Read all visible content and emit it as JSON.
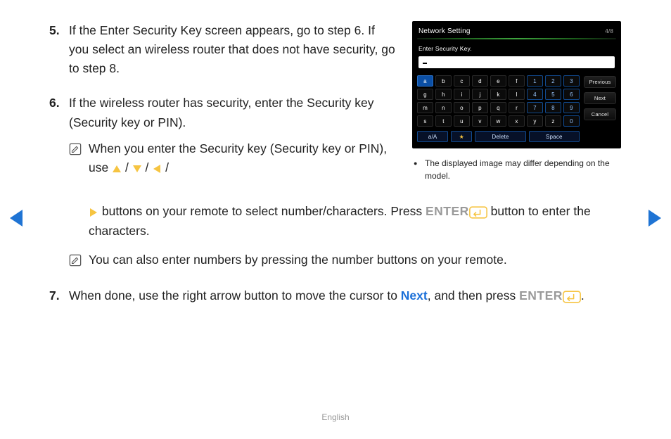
{
  "steps": {
    "s5": {
      "num": "5.",
      "text": "If the Enter Security Key screen appears, go to step 6. If you select an wireless router that does not have security, go to step 8."
    },
    "s6": {
      "num": "6.",
      "text": "If the wireless router has security, enter the Security key (Security key or PIN)."
    },
    "note1a": "When you enter the Security key (Security key or PIN), use ",
    "note1b": " buttons on your remote to select number/characters. Press ",
    "note1c": " button to enter the characters.",
    "note2": "You can also enter numbers by pressing the number buttons on your remote.",
    "s7": {
      "num": "7.",
      "a": "When done, use the right arrow button to move the cursor to ",
      "next": "Next",
      "b": ", and then press "
    }
  },
  "enter": "ENTER",
  "slash": " / ",
  "footer": "English",
  "shot": {
    "title": "Network Setting",
    "page": "4/8",
    "label": "Enter Security Key.",
    "rows": [
      [
        "a",
        "b",
        "c",
        "d",
        "e",
        "f",
        "1",
        "2",
        "3"
      ],
      [
        "g",
        "h",
        "i",
        "j",
        "k",
        "l",
        "4",
        "5",
        "6"
      ],
      [
        "m",
        "n",
        "o",
        "p",
        "q",
        "r",
        "7",
        "8",
        "9"
      ],
      [
        "s",
        "t",
        "u",
        "v",
        "w",
        "x",
        "y",
        "z",
        "0"
      ]
    ],
    "bottom": {
      "aA": "a/A",
      "star": "★",
      "delete": "Delete",
      "space": "Space"
    },
    "side": {
      "prev": "Previous",
      "next": "Next",
      "cancel": "Cancel"
    }
  },
  "caption": "The displayed image may differ depending on the model."
}
